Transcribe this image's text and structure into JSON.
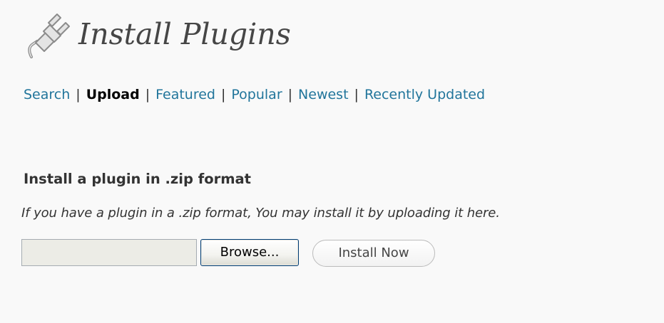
{
  "header": {
    "title": "Install Plugins",
    "icon": "plugin-plug-icon"
  },
  "subnav": {
    "items": [
      {
        "label": "Search",
        "current": false
      },
      {
        "label": "Upload",
        "current": true
      },
      {
        "label": "Featured",
        "current": false
      },
      {
        "label": "Popular",
        "current": false
      },
      {
        "label": "Newest",
        "current": false
      },
      {
        "label": "Recently Updated",
        "current": false
      }
    ],
    "separator": "|"
  },
  "upload": {
    "title": "Install a plugin in .zip format",
    "description": "If you have a plugin in a .zip format, You may install it by uploading it here.",
    "file_value": "",
    "browse_label": "Browse...",
    "install_label": "Install Now"
  },
  "colors": {
    "link": "#21759b",
    "background": "#f9f9f9",
    "text": "#333333"
  }
}
